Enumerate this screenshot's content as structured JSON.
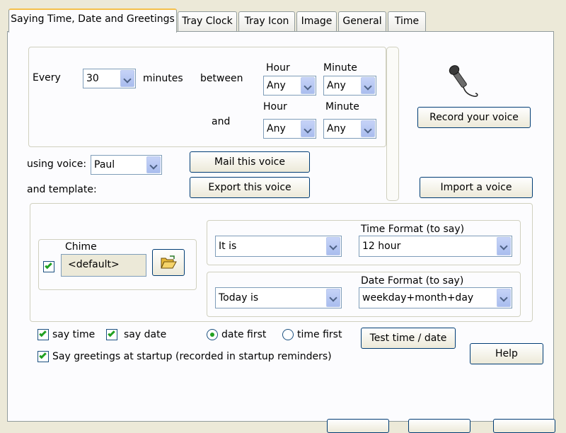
{
  "tabs": [
    {
      "label": "Saying Time, Date and Greetings"
    },
    {
      "label": "Tray Clock"
    },
    {
      "label": "Tray Icon"
    },
    {
      "label": "Image"
    },
    {
      "label": "General"
    },
    {
      "label": "Time"
    }
  ],
  "schedule": {
    "every_label": "Every",
    "interval_value": "30",
    "minutes_label": "minutes",
    "between_label": "between",
    "and_label": "and",
    "hour_label": "Hour",
    "minute_label": "Minute",
    "start_hour": "Any",
    "start_minute": "Any",
    "end_hour": "Any",
    "end_minute": "Any"
  },
  "voice": {
    "using_voice_label": "using voice:",
    "voice_value": "Paul",
    "template_label": "and template:",
    "mail_button": "Mail this voice",
    "export_button": "Export this voice",
    "record_button": "Record your voice",
    "import_button": "Import a voice"
  },
  "chime": {
    "label": "Chime",
    "value": "<default>",
    "checked": true
  },
  "time_format": {
    "label": "Time Format (to say)",
    "prefix_value": "It is",
    "format_value": "12 hour"
  },
  "date_format": {
    "label": "Date Format (to say)",
    "prefix_value": "Today is",
    "format_value": "weekday+month+day"
  },
  "options": {
    "say_time_label": "say time",
    "say_date_label": "say date",
    "date_first_label": "date first",
    "time_first_label": "time first",
    "greetings_label": "Say greetings at startup (recorded in startup reminders)",
    "selected_order": "date first"
  },
  "actions": {
    "test_button": "Test time / date",
    "help_button": "Help"
  },
  "colors": {
    "window_bg": "#ece9d8",
    "panel_bg": "#fcfcfe",
    "active_tab_accent": "#f5c04a",
    "check_green": "#21a121"
  }
}
